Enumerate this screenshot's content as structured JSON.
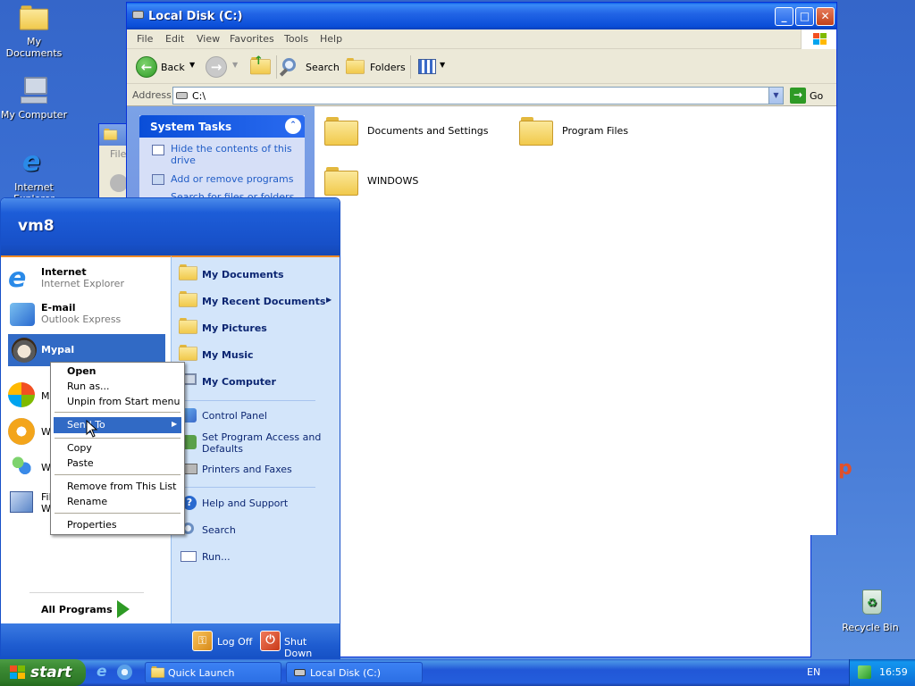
{
  "desktop": {
    "icons": [
      {
        "label": "My Documents"
      },
      {
        "label": "My Computer"
      },
      {
        "label": "Internet Explorer"
      },
      {
        "label": "Recycle Bin"
      }
    ]
  },
  "explorer": {
    "title": "Local Disk (C:)",
    "menu": [
      "File",
      "Edit",
      "View",
      "Favorites",
      "Tools",
      "Help"
    ],
    "toolbar": {
      "back": "Back",
      "search": "Search",
      "folders": "Folders"
    },
    "address": {
      "label": "Address",
      "value": "C:\\",
      "go": "Go"
    },
    "tasks": {
      "title": "System Tasks",
      "items": [
        "Hide the contents of this drive",
        "Add or remove programs",
        "Search for files or folders"
      ]
    },
    "folders": [
      "Documents and Settings",
      "Program Files",
      "WINDOWS"
    ]
  },
  "back_window": {
    "menu_fragment": "File"
  },
  "start_menu": {
    "user": "vm8",
    "pinned": [
      {
        "title": "Internet",
        "subtitle": "Internet Explorer"
      },
      {
        "title": "E-mail",
        "subtitle": "Outlook Express"
      },
      {
        "title": "Mypal",
        "subtitle": ""
      }
    ],
    "mfu_fragments": [
      "MS",
      "W",
      "W",
      "Fil",
      "W"
    ],
    "all_programs": "All Programs",
    "right_items": [
      {
        "label": "My Documents",
        "bold": true
      },
      {
        "label": "My Recent Documents",
        "bold": true
      },
      {
        "label": "My Pictures",
        "bold": true
      },
      {
        "label": "My Music",
        "bold": true
      },
      {
        "label": "My Computer",
        "bold": true
      },
      {
        "label": "Control Panel",
        "bold": false
      },
      {
        "label": "Set Program Access and Defaults",
        "bold": false
      },
      {
        "label": "Printers and Faxes",
        "bold": false
      },
      {
        "label": "Help and Support",
        "bold": false
      },
      {
        "label": "Search",
        "bold": false
      },
      {
        "label": "Run...",
        "bold": false
      }
    ],
    "logoff": "Log Off",
    "shutdown": "Shut Down"
  },
  "context_menu": {
    "items": [
      "Open",
      "Run as...",
      "Unpin from Start menu",
      "Send To",
      "Copy",
      "Paste",
      "Remove from This List",
      "Rename",
      "Properties"
    ],
    "highlighted": "Send To"
  },
  "taskbar": {
    "start": "start",
    "tasks": [
      "Quick Launch",
      "Local Disk (C:)"
    ],
    "language": "EN",
    "clock": "16:59"
  },
  "colors": {
    "accent": "#316ac5",
    "start_green": "#3c8b34",
    "title_blue": "#0a4ed8"
  }
}
